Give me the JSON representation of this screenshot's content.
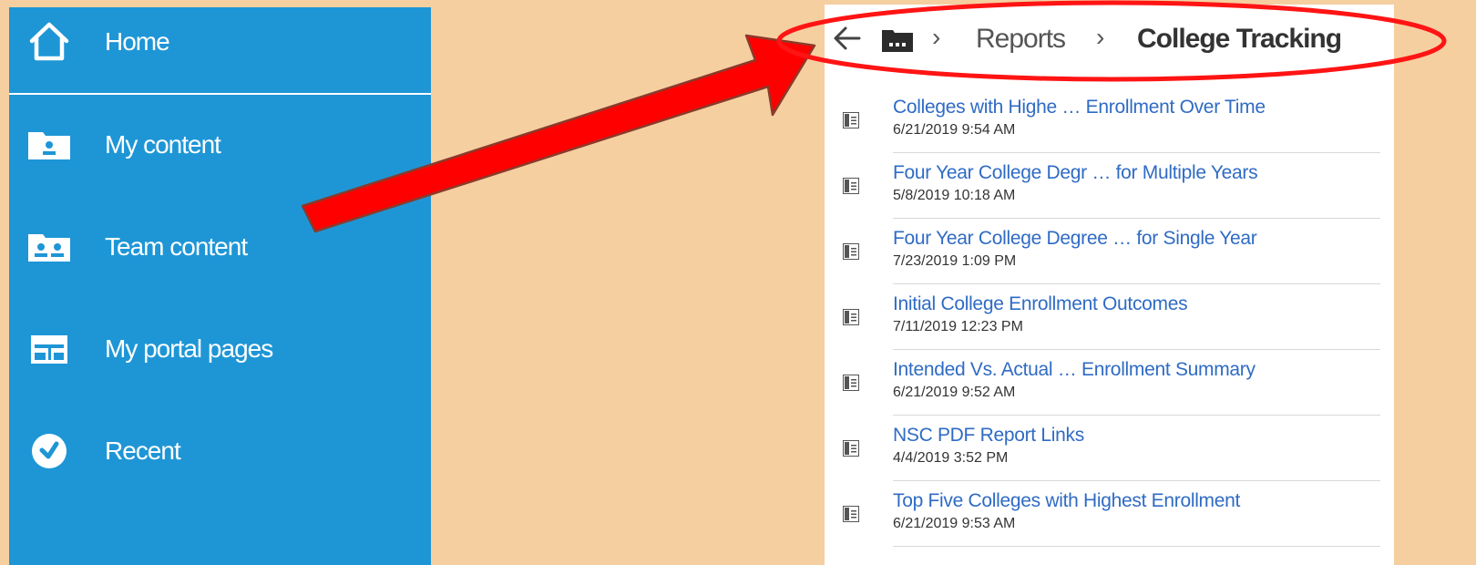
{
  "nav": {
    "items": [
      {
        "label": "Home",
        "icon": "home-icon"
      },
      {
        "label": "My content",
        "icon": "my-content-icon"
      },
      {
        "label": "Team content",
        "icon": "team-content-icon"
      },
      {
        "label": "My portal pages",
        "icon": "portal-pages-icon"
      },
      {
        "label": "Recent",
        "icon": "recent-icon"
      }
    ]
  },
  "breadcrumb": {
    "back_icon": "back-arrow-icon",
    "root_icon": "folder-icon",
    "separator": "›",
    "parent": "Reports",
    "current": "College Tracking"
  },
  "reports": [
    {
      "title": "Colleges with Highe … Enrollment Over Time",
      "date": "6/21/2019 9:54 AM"
    },
    {
      "title": "Four Year College Degr … for Multiple Years",
      "date": "5/8/2019 10:18 AM"
    },
    {
      "title": "Four Year College Degree … for Single Year",
      "date": "7/23/2019 1:09 PM"
    },
    {
      "title": "Initial College Enrollment Outcomes",
      "date": "7/11/2019 12:23 PM"
    },
    {
      "title": "Intended Vs. Actual … Enrollment Summary",
      "date": "6/21/2019 9:52 AM"
    },
    {
      "title": "NSC PDF Report Links",
      "date": "4/4/2019 3:52 PM"
    },
    {
      "title": "Top Five Colleges with Highest Enrollment",
      "date": "6/21/2019 9:53 AM"
    }
  ],
  "colors": {
    "background": "#f5cfa0",
    "nav_bg": "#1e96d6",
    "link": "#2f6bc4",
    "annotation": "#ff0000"
  }
}
